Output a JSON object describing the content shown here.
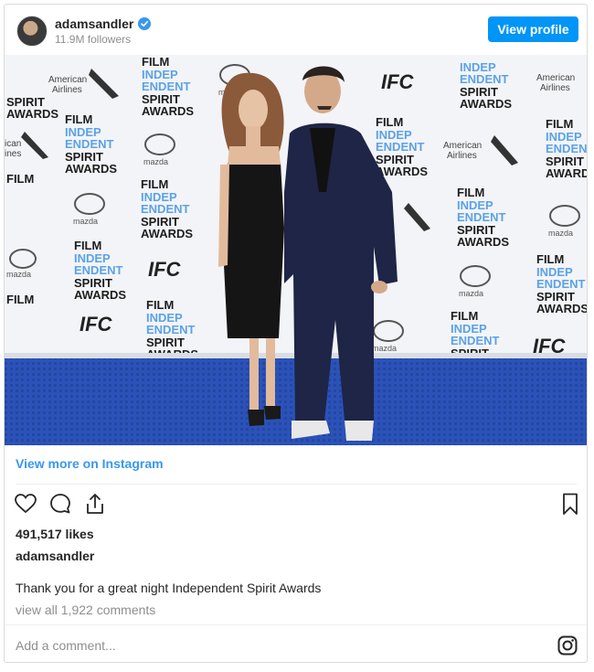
{
  "header": {
    "username": "adamsandler",
    "followers": "11.9M followers",
    "view_profile_label": "View profile"
  },
  "photo": {
    "backdrop_logos": [
      "American Airlines",
      "FILM INDEP ENDENT SPIRIT AWARDS",
      "mazda",
      "IFC"
    ]
  },
  "view_more_label": "View more on Instagram",
  "likes": "491,517 likes",
  "owner_username": "adamsandler",
  "caption": "Thank you for a great night Independent Spirit Awards",
  "view_comments": "view all 1,922 comments",
  "comment_placeholder": "Add a comment...",
  "colors": {
    "accent": "#0095f6",
    "link": "#3897f0",
    "carpet": "#2a4fb0"
  }
}
